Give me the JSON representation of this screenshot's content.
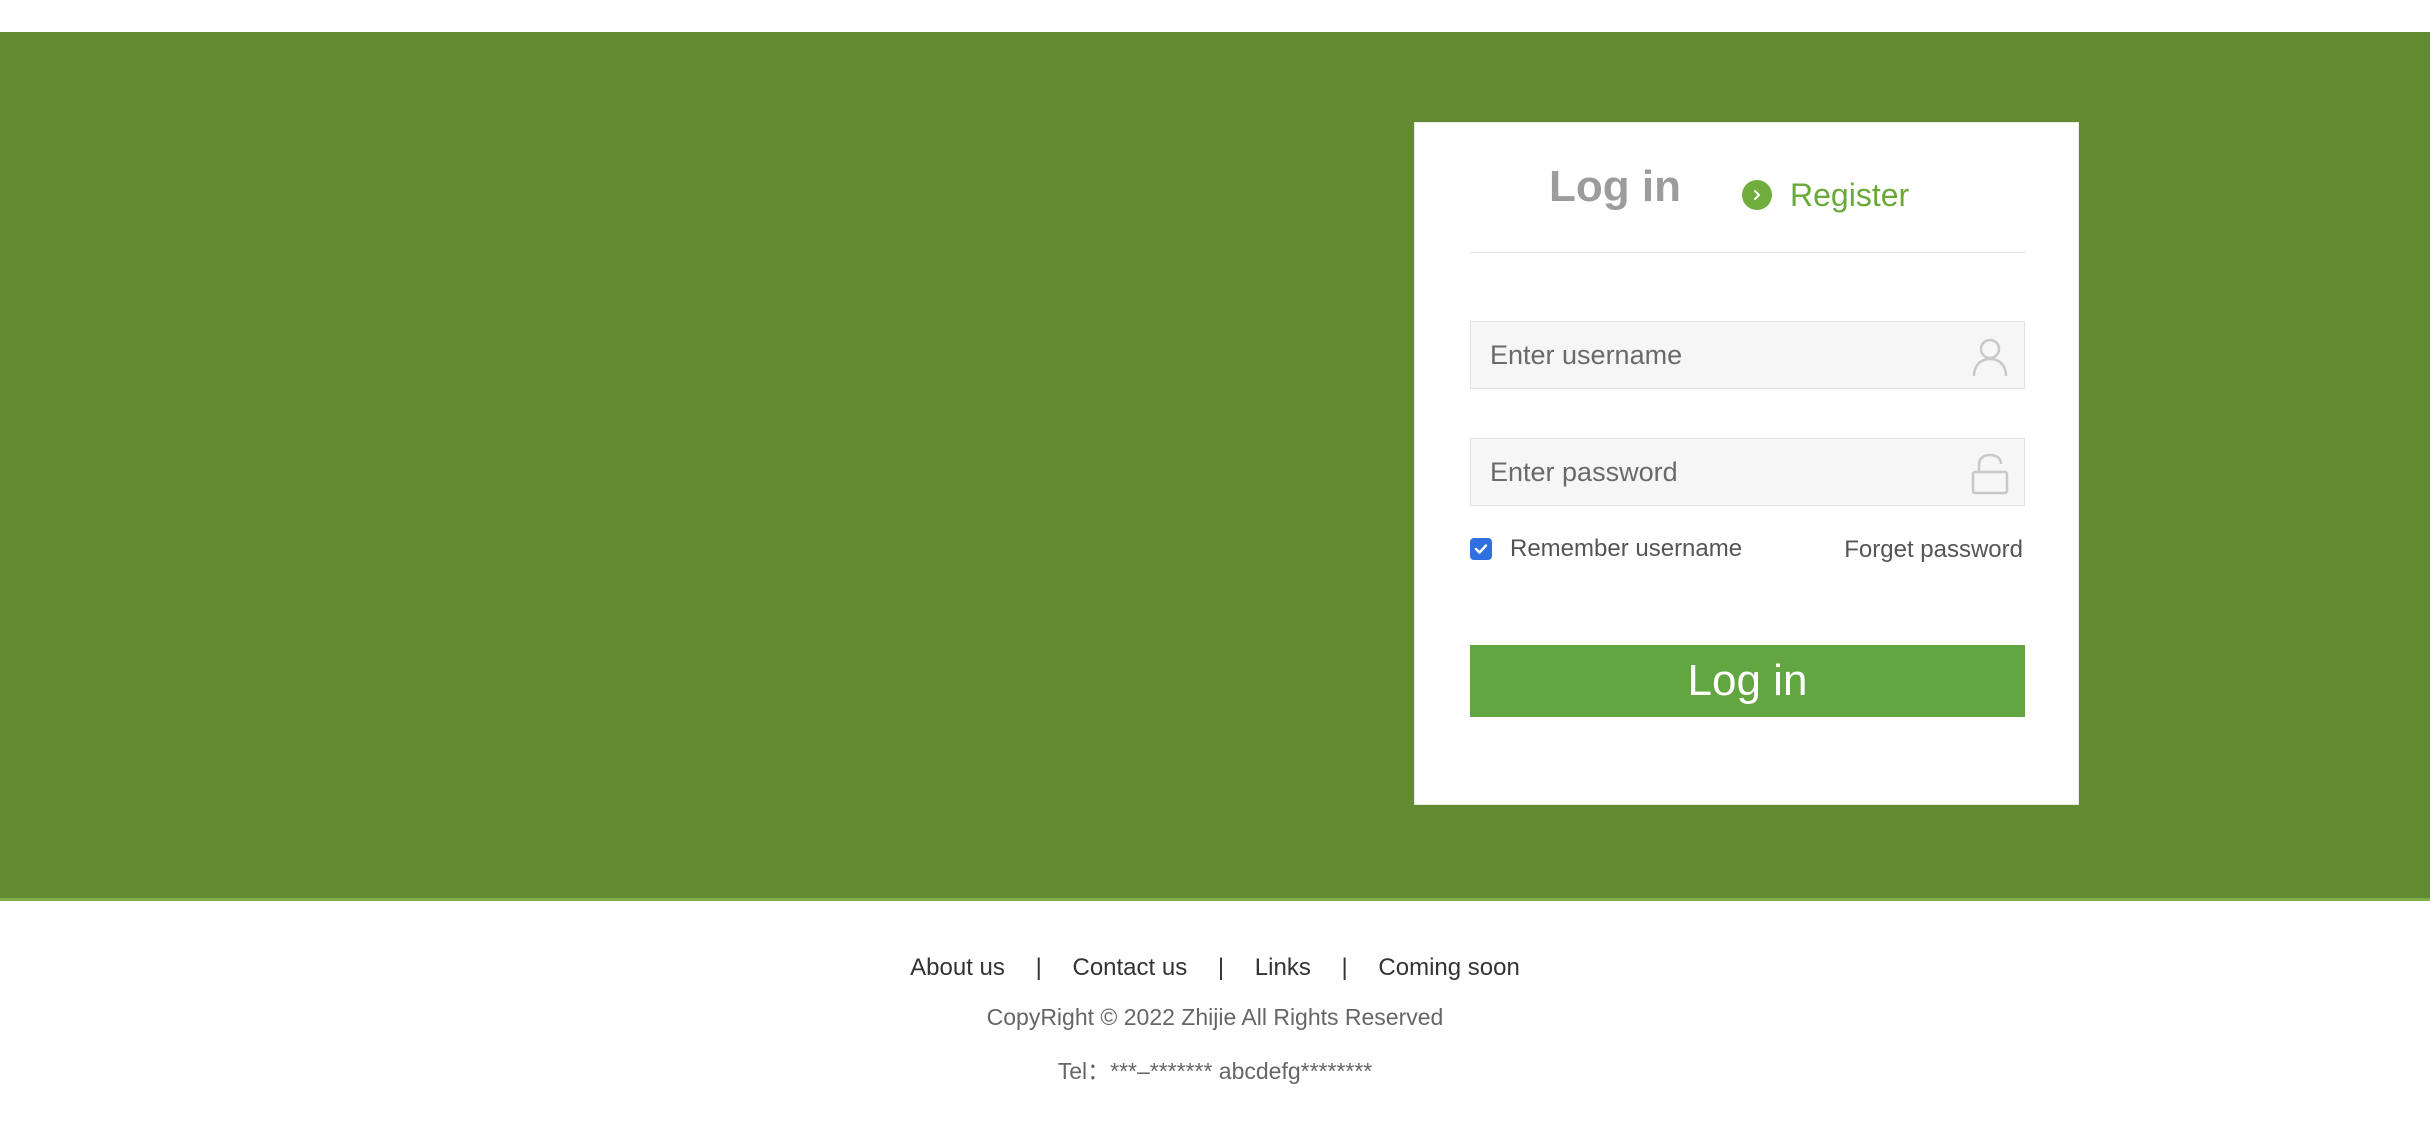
{
  "colors": {
    "hero_background": "#628b31",
    "accent_green": "#62a642",
    "register_green": "#6aa83a",
    "checkbox_blue": "#2f6fe0"
  },
  "login_card": {
    "tab_login": "Log in",
    "tab_register": "Register",
    "register_icon": "chevron-circle-icon",
    "username": {
      "placeholder": "Enter username",
      "value": "",
      "icon": "user-icon"
    },
    "password": {
      "placeholder": "Enter password",
      "value": "",
      "icon": "unlock-icon"
    },
    "remember": {
      "label": "Remember username",
      "checked": true
    },
    "forget_password": "Forget password",
    "submit_label": "Log in"
  },
  "footer": {
    "links": [
      "About us",
      "Contact us",
      "Links",
      "Coming soon"
    ],
    "separator": "|",
    "copyright": "CopyRight © 2022 Zhijie All Rights Reserved",
    "tel": "Tel：***–******* abcdefg********"
  }
}
